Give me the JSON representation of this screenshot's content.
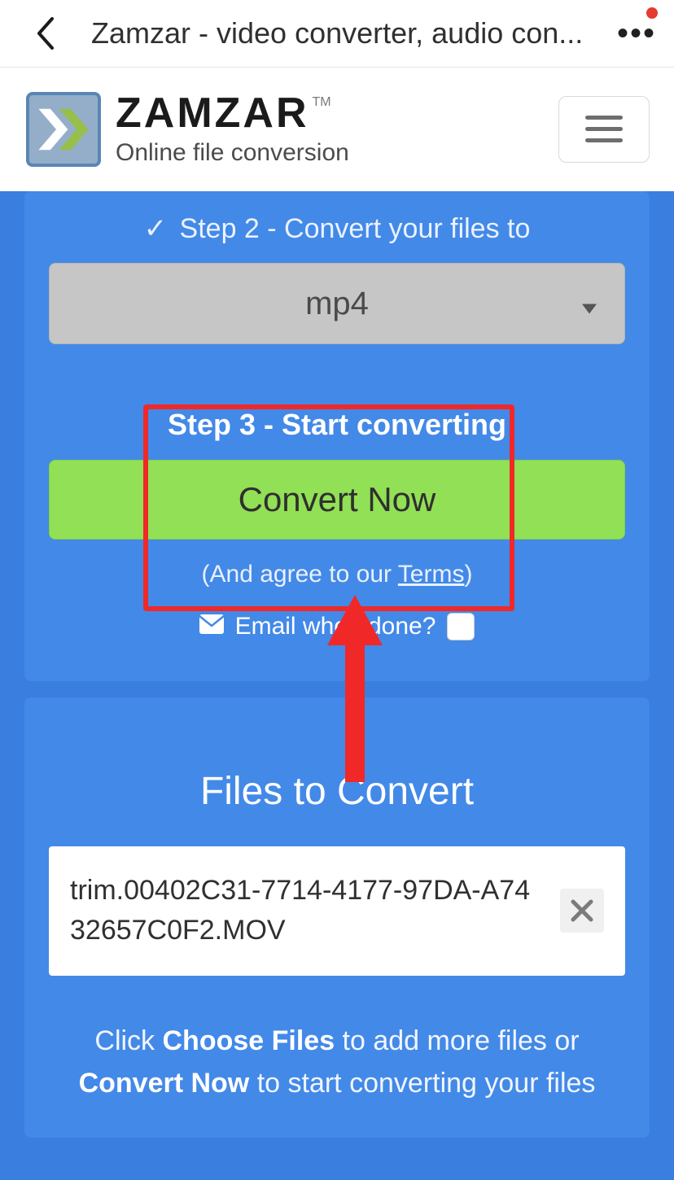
{
  "browser": {
    "title": "Zamzar - video converter, audio con..."
  },
  "header": {
    "brand": "ZAMZAR",
    "tm": "TM",
    "tagline": "Online file conversion"
  },
  "step2": {
    "label": "Step 2 - Convert your files to",
    "check": "✓",
    "selected_format": "mp4"
  },
  "step3": {
    "label": "Step 3 - Start converting",
    "button": "Convert Now",
    "terms_prefix": "(And agree to our ",
    "terms_link": "Terms",
    "terms_suffix": ")",
    "email_label": "Email when done?"
  },
  "files": {
    "title": "Files to Convert",
    "items": [
      {
        "name": "trim.00402C31-7714-4177-97DA-A7432657C0F2.MOV"
      }
    ],
    "hint_1": "Click ",
    "hint_choose": "Choose Files",
    "hint_2": " to add more files or ",
    "hint_convert": "Convert Now",
    "hint_3": " to start converting your files"
  }
}
